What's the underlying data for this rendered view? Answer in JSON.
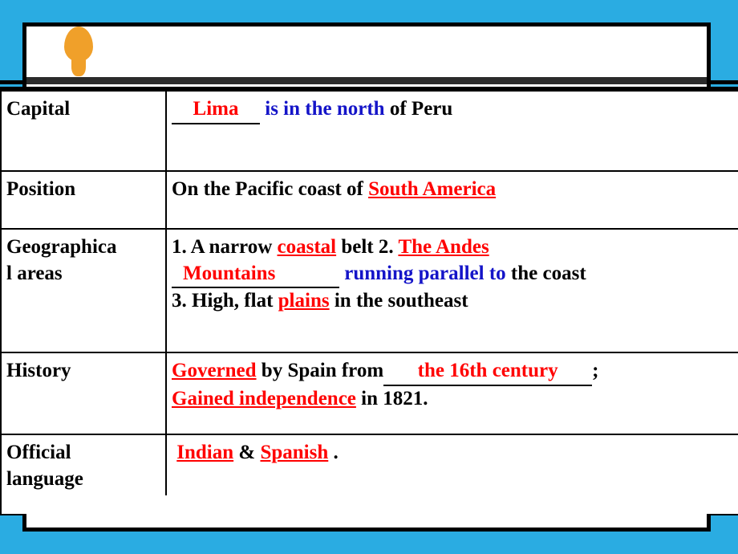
{
  "slide": {
    "background_color": "#2aace2",
    "panel_color": "#ffffff",
    "accent_color": "#f0a02a",
    "red": "#ff0000",
    "blue": "#1414c8"
  },
  "marker": {
    "name": "orange-balloon-pin"
  },
  "table": {
    "rows": [
      {
        "label": "Capital",
        "value_parts": [
          {
            "text": "Lima",
            "style": "blank-red"
          },
          {
            "text": "is in the north",
            "style": "blue"
          },
          {
            "text": "of Peru",
            "style": "black"
          }
        ]
      },
      {
        "label": "Position",
        "value_parts": [
          {
            "text": "On the Pacific coast of",
            "style": "black"
          },
          {
            "text": "South America",
            "style": "underline-red"
          }
        ]
      },
      {
        "label": "Geographical areas",
        "value_parts": [
          {
            "text": "1. A narrow",
            "style": "black"
          },
          {
            "text": "coastal",
            "style": "underline-red"
          },
          {
            "text": "belt 2.",
            "style": "black"
          },
          {
            "text": "The Andes",
            "style": "underline-red"
          },
          {
            "text": "Mountains",
            "style": "blank-red"
          },
          {
            "text": "running parallel to",
            "style": "blue"
          },
          {
            "text": "the coast",
            "style": "black"
          },
          {
            "text": "3. High, flat",
            "style": "black"
          },
          {
            "text": "plains",
            "style": "underline-red"
          },
          {
            "text": "in the southeast",
            "style": "black"
          }
        ]
      },
      {
        "label": "History",
        "value_parts": [
          {
            "text": "Governed",
            "style": "underline-red"
          },
          {
            "text": "by Spain from",
            "style": "black"
          },
          {
            "text": "the 16th century",
            "style": "blank-red"
          },
          {
            "text": ";",
            "style": "black"
          },
          {
            "text": "Gained independence",
            "style": "underline-red"
          },
          {
            "text": "in 1821.",
            "style": "black"
          }
        ]
      },
      {
        "label": "Official language",
        "value_parts": [
          {
            "text": "Indian",
            "style": "underline-red"
          },
          {
            "text": "&",
            "style": "black"
          },
          {
            "text": "Spanish",
            "style": "underline-red"
          },
          {
            "text": ".",
            "style": "black"
          }
        ]
      }
    ]
  },
  "text": {
    "capital_label": "Capital",
    "capital_blank": "Lima",
    "capital_blue": "is in the north",
    "capital_tail": "of Peru",
    "position_label": "Position",
    "position_head": "On the Pacific coast of ",
    "position_answer": "South America",
    "geo_label_l1": "Geographica",
    "geo_label_l2": "l areas",
    "geo_l1_a": "1. A narrow ",
    "geo_l1_b": "coastal",
    "geo_l1_c": " belt 2. ",
    "geo_l1_d": "The Andes",
    "geo_l2_a": "Mountains",
    "geo_l2_b": "running parallel to",
    "geo_l2_c": " the coast",
    "geo_l3_a": "3. High, flat ",
    "geo_l3_b": "plains",
    "geo_l3_c": " in the southeast",
    "history_label": "History",
    "history_l1_a": "Governed",
    "history_l1_b": " by Spain from",
    "history_l1_c": "the 16th century",
    "history_l1_d": ";",
    "history_l2_a": "Gained independence",
    "history_l2_b": " in 1821.",
    "official_label_l1": "Official",
    "official_label_l2": "language",
    "official_a": "Indian",
    "official_b": " & ",
    "official_c": "Spanish",
    "official_d": " ."
  }
}
